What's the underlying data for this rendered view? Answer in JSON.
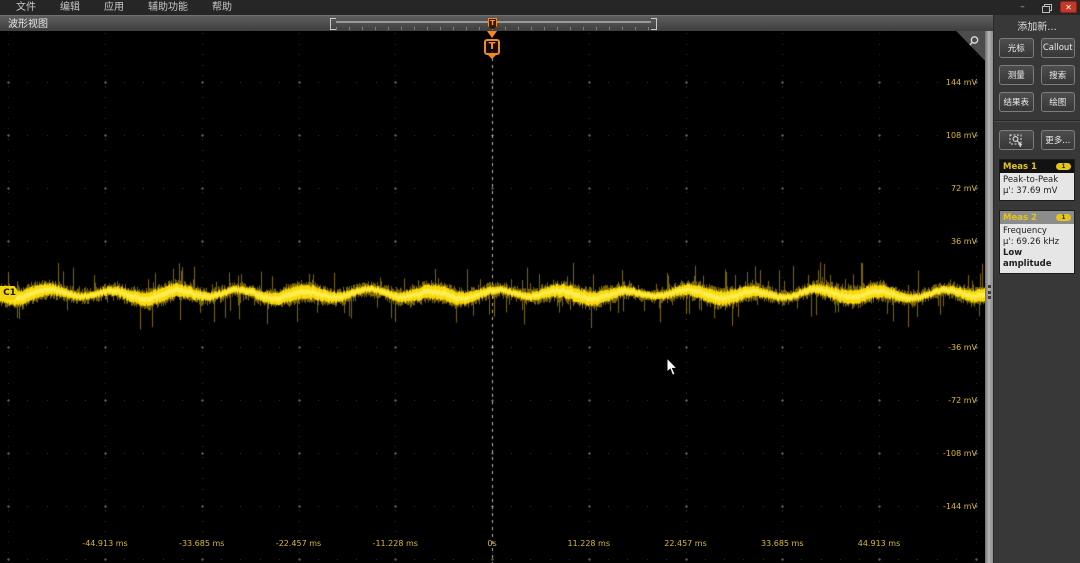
{
  "menu": {
    "items": [
      {
        "label": "文件"
      },
      {
        "label": "编辑"
      },
      {
        "label": "应用"
      },
      {
        "label": "辅助功能"
      },
      {
        "label": "帮助"
      }
    ]
  },
  "window_controls": {
    "minimize": "–",
    "close": "✕"
  },
  "view": {
    "title": "波形视图"
  },
  "minimap": {
    "trigger_marker": "T"
  },
  "plot": {
    "channel_badge": "C1",
    "trigger_flag": "T"
  },
  "sidebar": {
    "add_new_label": "添加新...",
    "buttons": [
      {
        "label": "光标"
      },
      {
        "label": "Callout"
      },
      {
        "label": "测量"
      },
      {
        "label": "搜索"
      },
      {
        "label": "结果表"
      },
      {
        "label": "绘图"
      },
      {
        "label": "",
        "icon": "zoom-select"
      },
      {
        "label": "更多..."
      }
    ],
    "measurements": [
      {
        "title": "Meas 1",
        "badge": "1",
        "name": "Peak-to-Peak",
        "value": "µ': 37.69 mV",
        "warning": ""
      },
      {
        "title": "Meas 2",
        "badge": "1",
        "name": "Frequency",
        "value": "µ': 69.26 kHz",
        "warning": "Low amplitude"
      }
    ]
  },
  "chart_data": {
    "type": "line",
    "title": "Oscilloscope waveform view, channel C1 noise trace",
    "x_axis": {
      "unit": "ms",
      "time_per_div": 11.228,
      "tick_labels": [
        "-44.913 ms",
        "-33.685 ms",
        "-22.457 ms",
        "-11.228 ms",
        "0s",
        "11.228 ms",
        "22.457 ms",
        "33.685 ms",
        "44.913 ms"
      ],
      "range": [
        -56.14,
        56.14
      ]
    },
    "y_axis": {
      "unit": "mV",
      "volts_per_div": 36,
      "tick_labels": [
        "144 mV",
        "108 mV",
        "72 mV",
        "36 mV",
        "-36 mV",
        "-72 mV",
        "-108 mV",
        "-144 mV"
      ],
      "range": [
        -180,
        180
      ]
    },
    "series": [
      {
        "name": "C1",
        "color": "#ffe10a",
        "description": "dense noise band centered at 0 mV with slow ripple and random spikes",
        "mean_mV": 0,
        "peak_to_peak_mV": 37.69,
        "frequency_kHz": 69.26
      }
    ],
    "trigger": {
      "time": "0s",
      "marker": "T",
      "color": "#f08828",
      "style": "dashed-vertical"
    },
    "grid": "dotted",
    "legend": "none"
  },
  "colors": {
    "waveform_yellow": "#ffe10a",
    "axis_label_yellow": "#d9b92e",
    "trigger_orange": "#f08828",
    "grid_dot": "#3f3f3f",
    "close_red": "#c0392b"
  }
}
